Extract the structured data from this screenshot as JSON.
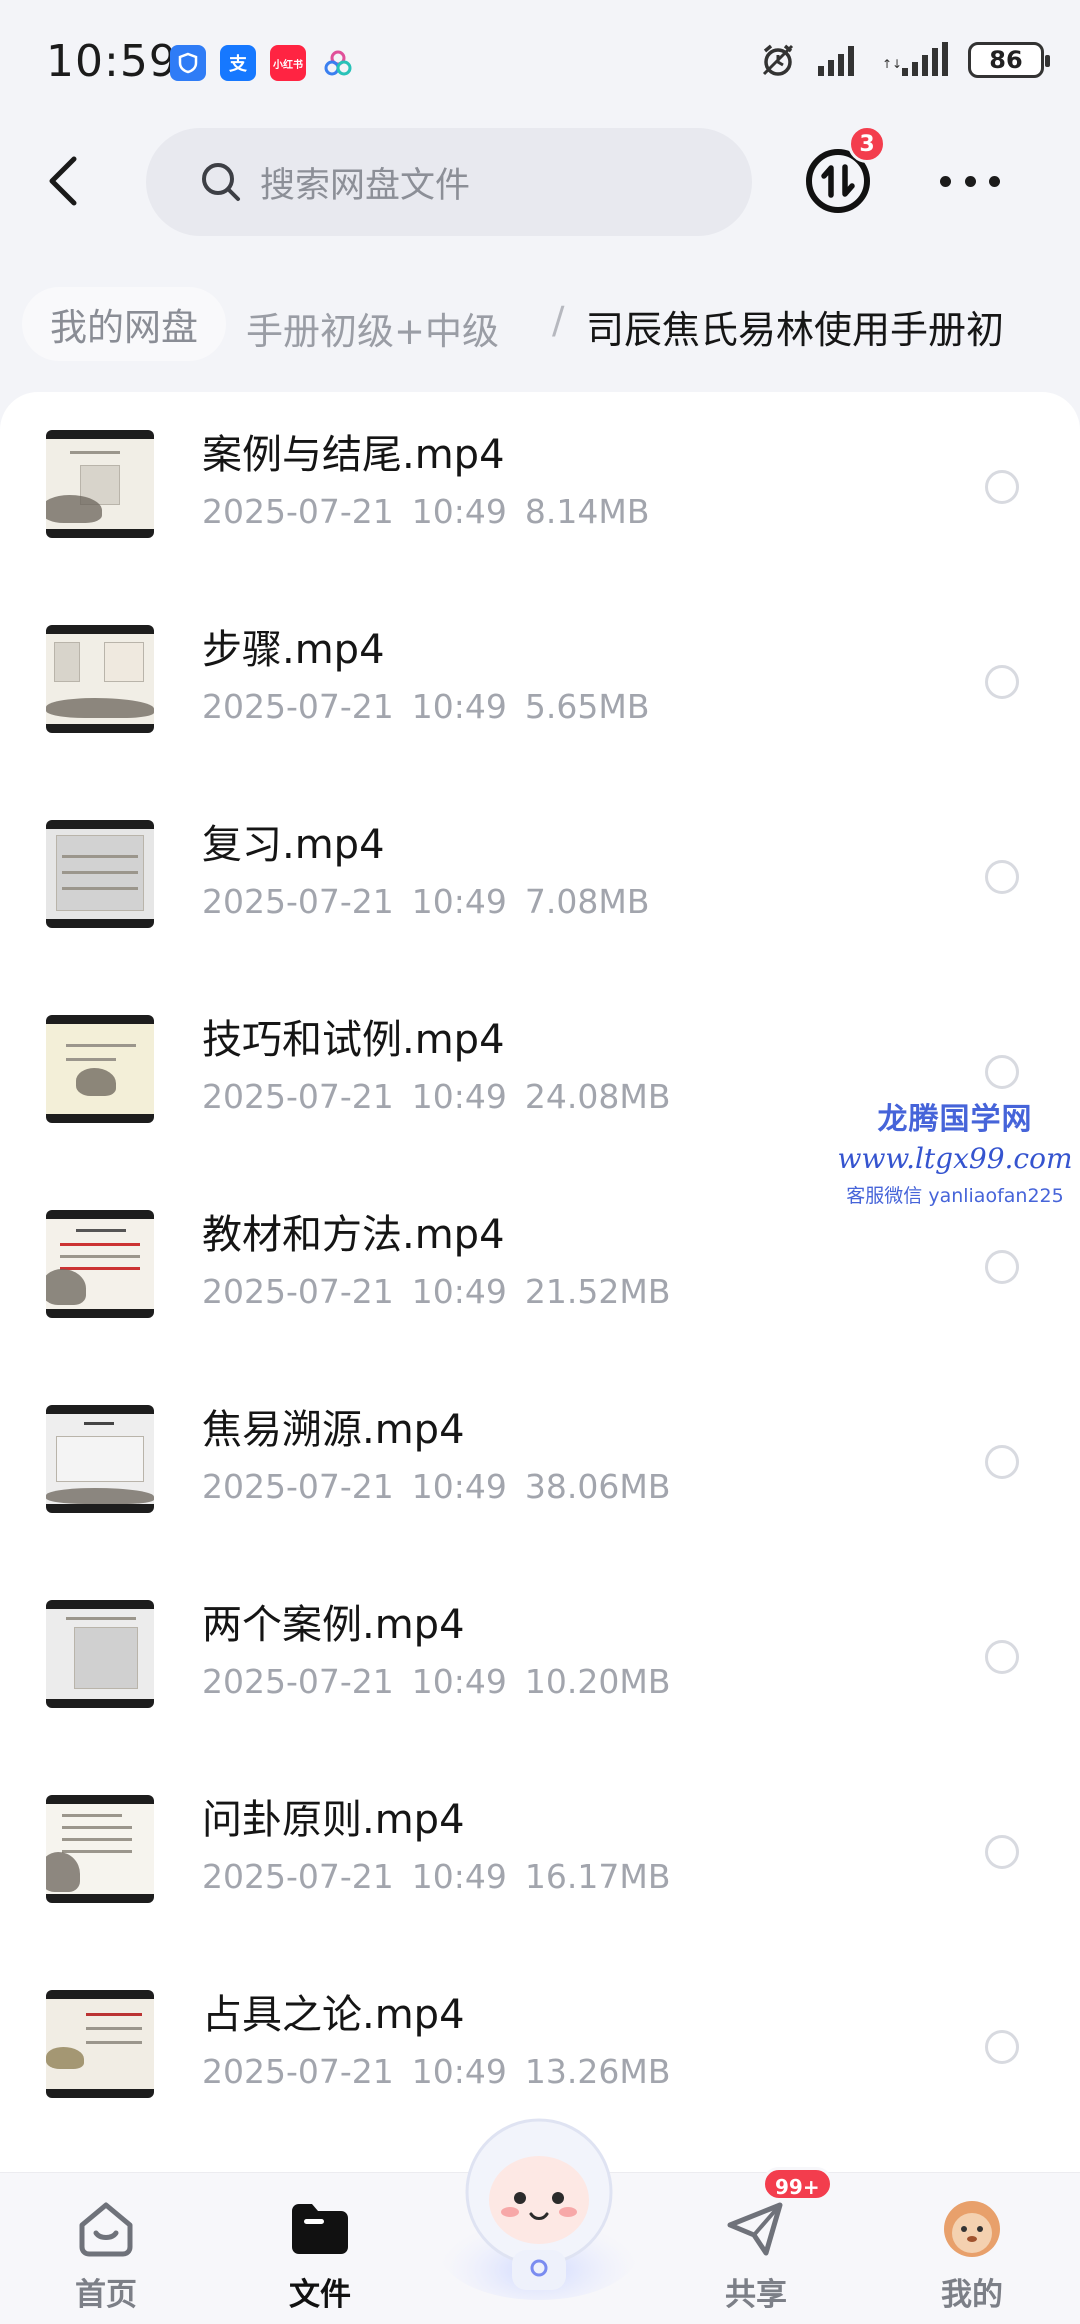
{
  "status_bar": {
    "time": "10:59",
    "battery": "86",
    "app_icons": [
      {
        "icon": "shield-app-icon",
        "label": "",
        "color": "#2f7cf6"
      },
      {
        "icon": "alipay-icon",
        "label": "支",
        "color": "#1678ff"
      },
      {
        "icon": "xiaohongshu-icon",
        "label": "小红书",
        "color": "#ff2442"
      },
      {
        "icon": "cloud-app-icon",
        "label": "",
        "color": "#ffffff"
      }
    ]
  },
  "header": {
    "search_placeholder": "搜索网盘文件",
    "transfer_badge": "3"
  },
  "breadcrumb": {
    "root": "我的网盘",
    "middle": "手册初级+中级",
    "separator": "/",
    "current": "司辰焦氏易林使用手册初"
  },
  "files": [
    {
      "name": "案例与结尾.mp4",
      "date": "2025-07-21",
      "time": "10:49",
      "size": "8.14MB"
    },
    {
      "name": "步骤.mp4",
      "date": "2025-07-21",
      "time": "10:49",
      "size": "5.65MB"
    },
    {
      "name": "复习.mp4",
      "date": "2025-07-21",
      "time": "10:49",
      "size": "7.08MB"
    },
    {
      "name": "技巧和试例.mp4",
      "date": "2025-07-21",
      "time": "10:49",
      "size": "24.08MB"
    },
    {
      "name": "教材和方法.mp4",
      "date": "2025-07-21",
      "time": "10:49",
      "size": "21.52MB"
    },
    {
      "name": "焦易溯源.mp4",
      "date": "2025-07-21",
      "time": "10:49",
      "size": "38.06MB"
    },
    {
      "name": "两个案例.mp4",
      "date": "2025-07-21",
      "time": "10:49",
      "size": "10.20MB"
    },
    {
      "name": "问卦原则.mp4",
      "date": "2025-07-21",
      "time": "10:49",
      "size": "16.17MB"
    },
    {
      "name": "占具之论.mp4",
      "date": "2025-07-21",
      "time": "10:49",
      "size": "13.26MB"
    }
  ],
  "watermark": {
    "title": "龙腾国学网",
    "url": "www.ltgx99.com",
    "contact": "客服微信 yanliaofan225"
  },
  "bottom_nav": {
    "home": "首页",
    "files": "文件",
    "share": "共享",
    "share_badge": "99+",
    "mine": "我的"
  },
  "colors": {
    "accent_red": "#f33d4d",
    "page_bg": "#f3f4f8",
    "watermark_blue": "#4664d9"
  }
}
